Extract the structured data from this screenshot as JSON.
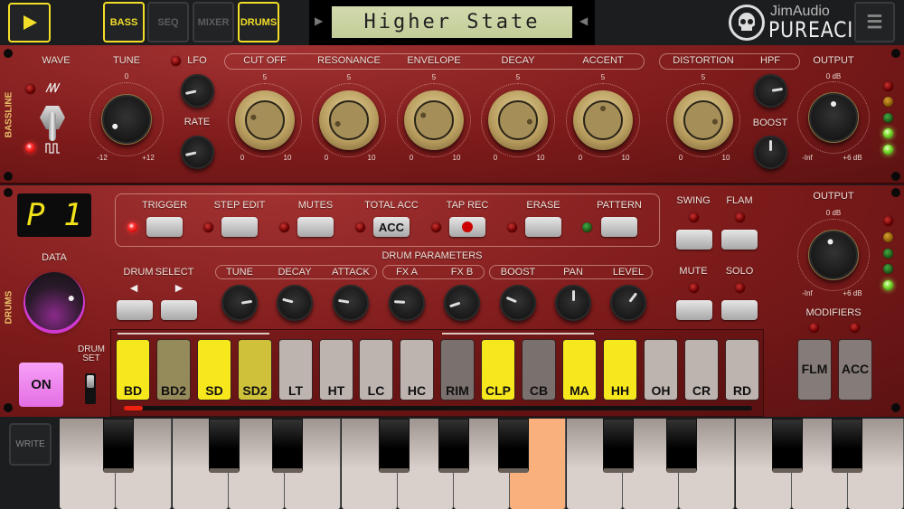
{
  "topbar": {
    "play_icon": "play-icon",
    "tabs": [
      {
        "label": "BASS",
        "active": true
      },
      {
        "label": "SEQ",
        "active": false
      },
      {
        "label": "MIXER",
        "active": false
      },
      {
        "label": "DRUMS",
        "active": true
      }
    ],
    "preset_prev": "◀",
    "preset_next": "▶",
    "preset_name": "Higher State",
    "logo": {
      "brand": "JimAudio",
      "product": "PUREACID"
    },
    "menu_icon": "menu-icon"
  },
  "bass": {
    "section_label": "BASSLINE",
    "wave": {
      "label": "WAVE",
      "options": [
        "saw",
        "square"
      ],
      "selected": "square"
    },
    "tune": {
      "label": "TUNE",
      "min": "-12",
      "mid": "0",
      "max": "+12",
      "value": 0.05
    },
    "lfo": {
      "label": "LFO",
      "value": 0.12
    },
    "rate": {
      "label": "RATE",
      "value": 0.12
    },
    "scale": {
      "min": "0",
      "mid": "5",
      "max": "10"
    },
    "filter_knobs": [
      {
        "label": "CUT OFF",
        "value": 0.22
      },
      {
        "label": "RESONANCE",
        "value": 0.1
      },
      {
        "label": "ENVELOPE",
        "value": 0.26
      },
      {
        "label": "DECAY",
        "value": 0.86
      },
      {
        "label": "ACCENT",
        "value": 0.5
      }
    ],
    "distortion": {
      "label": "DISTORTION",
      "value": 0.86
    },
    "hpf": {
      "label": "HPF",
      "value": 0.8
    },
    "boost": {
      "label": "BOOST",
      "value": 0.5
    },
    "output": {
      "label": "OUTPUT",
      "top": "0 dB",
      "min": "-Inf",
      "max": "+6 dB",
      "value": 0.5
    }
  },
  "drums": {
    "section_label": "DRUMS",
    "pattern_display": "P 1",
    "data_label": "DATA",
    "data_value": 0.8,
    "on_label": "ON",
    "drum_set_label": "DRUM SET",
    "mode_buttons": [
      {
        "label": "TRIGGER",
        "led": "on",
        "text": ""
      },
      {
        "label": "STEP EDIT",
        "led": "off",
        "text": ""
      },
      {
        "label": "MUTES",
        "led": "off",
        "text": ""
      },
      {
        "label": "TOTAL ACC",
        "led": "off",
        "text": "ACC"
      },
      {
        "label": "TAP REC",
        "led": "off",
        "text": ""
      },
      {
        "label": "ERASE",
        "led": "off",
        "text": ""
      },
      {
        "label": "PATTERN",
        "led": "green",
        "text": ""
      }
    ],
    "params_title": "DRUM PARAMETERS",
    "drum_select": {
      "label1": "DRUM",
      "label2": "SELECT",
      "prev": "◄",
      "next": "►"
    },
    "params": [
      {
        "label": "TUNE",
        "value": 0.8
      },
      {
        "label": "DECAY",
        "value": 0.22
      },
      {
        "label": "ATTACK",
        "value": 0.2
      },
      {
        "label": "FX A",
        "value": 0.18
      },
      {
        "label": "FX B",
        "value": 0.1
      },
      {
        "label": "BOOST",
        "value": 0.25
      },
      {
        "label": "PAN",
        "value": 0.5
      },
      {
        "label": "LEVEL",
        "value": 0.64
      }
    ],
    "swing": "SWING",
    "flam": "FLAM",
    "mute": "MUTE",
    "solo": "SOLO",
    "output": {
      "label": "OUTPUT",
      "top": "0 dB",
      "min": "-Inf",
      "max": "+6 dB",
      "value": 0.45
    },
    "modifiers": {
      "label": "MODIFIERS",
      "flm": "FLM",
      "acc": "ACC"
    },
    "pads": [
      {
        "label": "BD",
        "color": "#f7e81e"
      },
      {
        "label": "BD2",
        "color": "#958a5a"
      },
      {
        "label": "SD",
        "color": "#f7e81e"
      },
      {
        "label": "SD2",
        "color": "#cfc23a"
      },
      {
        "label": "LT",
        "color": "#bdb4b0"
      },
      {
        "label": "HT",
        "color": "#bdb4b0"
      },
      {
        "label": "LC",
        "color": "#bdb4b0"
      },
      {
        "label": "HC",
        "color": "#bdb4b0"
      },
      {
        "label": "RIM",
        "color": "#7a716e"
      },
      {
        "label": "CLP",
        "color": "#f7e81e"
      },
      {
        "label": "CB",
        "color": "#7a716e"
      },
      {
        "label": "MA",
        "color": "#f7e81e"
      },
      {
        "label": "HH",
        "color": "#f7e81e"
      },
      {
        "label": "OH",
        "color": "#bdb4b0"
      },
      {
        "label": "CR",
        "color": "#bdb4b0"
      },
      {
        "label": "RD",
        "color": "#bdb4b0"
      }
    ],
    "step_progress": 0.03
  },
  "keyboard": {
    "write_label": "WRITE",
    "pressed_key": 8,
    "highlight_color": "#f9b07c"
  }
}
